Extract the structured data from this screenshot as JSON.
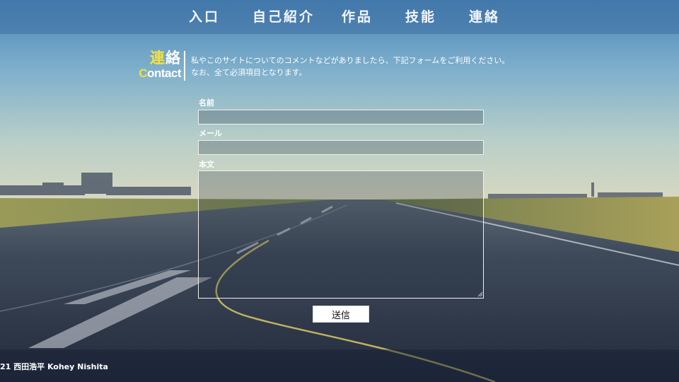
{
  "nav": {
    "items": [
      {
        "label": "入口"
      },
      {
        "label": "自己紹介"
      },
      {
        "label": "作品"
      },
      {
        "label": "技能"
      },
      {
        "label": "連絡"
      }
    ]
  },
  "heading": {
    "jp_first": "連",
    "jp_rest": "絡",
    "en_first": "C",
    "en_rest": "ontact"
  },
  "intro": {
    "line1": "私やこのサイトについてのコメントなどがありましたら、下記フォームをご利用ください。",
    "line2": "なお、全て必須項目となります。"
  },
  "form": {
    "name_label": "名前",
    "name_value": "",
    "email_label": "メール",
    "email_value": "",
    "body_label": "本文",
    "body_value": "",
    "submit_label": "送信"
  },
  "footer": {
    "text": "21 西田浩平 Kohey Nishita"
  },
  "colors": {
    "accent": "#f5e13a",
    "nav_bg": "#3c6ea0"
  }
}
